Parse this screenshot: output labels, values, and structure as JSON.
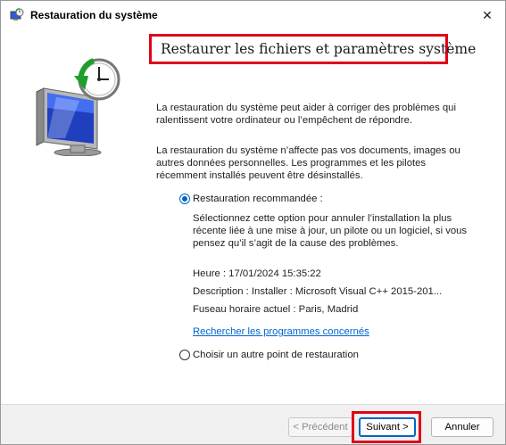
{
  "window": {
    "title": "Restauration du système",
    "close_glyph": "✕"
  },
  "main": {
    "heading": "Restaurer les fichiers et paramètres système",
    "paragraph1": "La restauration du système peut aider à corriger des problèmes qui ralentissent votre ordinateur ou l’empêchent de répondre.",
    "paragraph2": "La restauration du système n’affecte pas vos documents, images ou autres données personnelles. Les programmes et les pilotes récemment installés peuvent être désinstallés.",
    "option_recommended": {
      "label": "Restauration recommandée :",
      "selected": true,
      "description": "Sélectionnez cette option pour annuler l’installation la plus récente liée à une mise à jour, un pilote ou un logiciel, si vous pensez qu’il s’agit de la cause des problèmes.",
      "time": "Heure : 17/01/2024 15:35:22",
      "description_line": "Description : Installer : Microsoft Visual C++ 2015-201...",
      "timezone": "Fuseau horaire actuel : Paris, Madrid",
      "link": "Rechercher les programmes concernés"
    },
    "option_other": {
      "label": "Choisir un autre point de restauration",
      "selected": false
    }
  },
  "footer": {
    "prev": "< Précédent",
    "next": "Suivant >",
    "cancel": "Annuler"
  },
  "colors": {
    "highlight": "#e0001a",
    "accent": "#0067c0",
    "link": "#0066cc"
  },
  "icons": {
    "title": "system-restore-icon",
    "hero": "system-restore-monitor-clock-icon"
  }
}
